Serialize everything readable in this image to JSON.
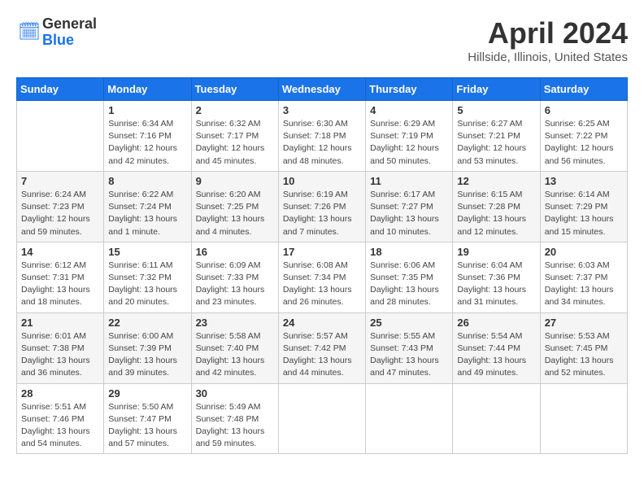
{
  "header": {
    "logo_general": "General",
    "logo_blue": "Blue",
    "month_title": "April 2024",
    "location": "Hillside, Illinois, United States"
  },
  "weekdays": [
    "Sunday",
    "Monday",
    "Tuesday",
    "Wednesday",
    "Thursday",
    "Friday",
    "Saturday"
  ],
  "weeks": [
    [
      {
        "day": "",
        "info": ""
      },
      {
        "day": "1",
        "info": "Sunrise: 6:34 AM\nSunset: 7:16 PM\nDaylight: 12 hours\nand 42 minutes."
      },
      {
        "day": "2",
        "info": "Sunrise: 6:32 AM\nSunset: 7:17 PM\nDaylight: 12 hours\nand 45 minutes."
      },
      {
        "day": "3",
        "info": "Sunrise: 6:30 AM\nSunset: 7:18 PM\nDaylight: 12 hours\nand 48 minutes."
      },
      {
        "day": "4",
        "info": "Sunrise: 6:29 AM\nSunset: 7:19 PM\nDaylight: 12 hours\nand 50 minutes."
      },
      {
        "day": "5",
        "info": "Sunrise: 6:27 AM\nSunset: 7:21 PM\nDaylight: 12 hours\nand 53 minutes."
      },
      {
        "day": "6",
        "info": "Sunrise: 6:25 AM\nSunset: 7:22 PM\nDaylight: 12 hours\nand 56 minutes."
      }
    ],
    [
      {
        "day": "7",
        "info": "Sunrise: 6:24 AM\nSunset: 7:23 PM\nDaylight: 12 hours\nand 59 minutes."
      },
      {
        "day": "8",
        "info": "Sunrise: 6:22 AM\nSunset: 7:24 PM\nDaylight: 13 hours\nand 1 minute."
      },
      {
        "day": "9",
        "info": "Sunrise: 6:20 AM\nSunset: 7:25 PM\nDaylight: 13 hours\nand 4 minutes."
      },
      {
        "day": "10",
        "info": "Sunrise: 6:19 AM\nSunset: 7:26 PM\nDaylight: 13 hours\nand 7 minutes."
      },
      {
        "day": "11",
        "info": "Sunrise: 6:17 AM\nSunset: 7:27 PM\nDaylight: 13 hours\nand 10 minutes."
      },
      {
        "day": "12",
        "info": "Sunrise: 6:15 AM\nSunset: 7:28 PM\nDaylight: 13 hours\nand 12 minutes."
      },
      {
        "day": "13",
        "info": "Sunrise: 6:14 AM\nSunset: 7:29 PM\nDaylight: 13 hours\nand 15 minutes."
      }
    ],
    [
      {
        "day": "14",
        "info": "Sunrise: 6:12 AM\nSunset: 7:31 PM\nDaylight: 13 hours\nand 18 minutes."
      },
      {
        "day": "15",
        "info": "Sunrise: 6:11 AM\nSunset: 7:32 PM\nDaylight: 13 hours\nand 20 minutes."
      },
      {
        "day": "16",
        "info": "Sunrise: 6:09 AM\nSunset: 7:33 PM\nDaylight: 13 hours\nand 23 minutes."
      },
      {
        "day": "17",
        "info": "Sunrise: 6:08 AM\nSunset: 7:34 PM\nDaylight: 13 hours\nand 26 minutes."
      },
      {
        "day": "18",
        "info": "Sunrise: 6:06 AM\nSunset: 7:35 PM\nDaylight: 13 hours\nand 28 minutes."
      },
      {
        "day": "19",
        "info": "Sunrise: 6:04 AM\nSunset: 7:36 PM\nDaylight: 13 hours\nand 31 minutes."
      },
      {
        "day": "20",
        "info": "Sunrise: 6:03 AM\nSunset: 7:37 PM\nDaylight: 13 hours\nand 34 minutes."
      }
    ],
    [
      {
        "day": "21",
        "info": "Sunrise: 6:01 AM\nSunset: 7:38 PM\nDaylight: 13 hours\nand 36 minutes."
      },
      {
        "day": "22",
        "info": "Sunrise: 6:00 AM\nSunset: 7:39 PM\nDaylight: 13 hours\nand 39 minutes."
      },
      {
        "day": "23",
        "info": "Sunrise: 5:58 AM\nSunset: 7:40 PM\nDaylight: 13 hours\nand 42 minutes."
      },
      {
        "day": "24",
        "info": "Sunrise: 5:57 AM\nSunset: 7:42 PM\nDaylight: 13 hours\nand 44 minutes."
      },
      {
        "day": "25",
        "info": "Sunrise: 5:55 AM\nSunset: 7:43 PM\nDaylight: 13 hours\nand 47 minutes."
      },
      {
        "day": "26",
        "info": "Sunrise: 5:54 AM\nSunset: 7:44 PM\nDaylight: 13 hours\nand 49 minutes."
      },
      {
        "day": "27",
        "info": "Sunrise: 5:53 AM\nSunset: 7:45 PM\nDaylight: 13 hours\nand 52 minutes."
      }
    ],
    [
      {
        "day": "28",
        "info": "Sunrise: 5:51 AM\nSunset: 7:46 PM\nDaylight: 13 hours\nand 54 minutes."
      },
      {
        "day": "29",
        "info": "Sunrise: 5:50 AM\nSunset: 7:47 PM\nDaylight: 13 hours\nand 57 minutes."
      },
      {
        "day": "30",
        "info": "Sunrise: 5:49 AM\nSunset: 7:48 PM\nDaylight: 13 hours\nand 59 minutes."
      },
      {
        "day": "",
        "info": ""
      },
      {
        "day": "",
        "info": ""
      },
      {
        "day": "",
        "info": ""
      },
      {
        "day": "",
        "info": ""
      }
    ]
  ]
}
